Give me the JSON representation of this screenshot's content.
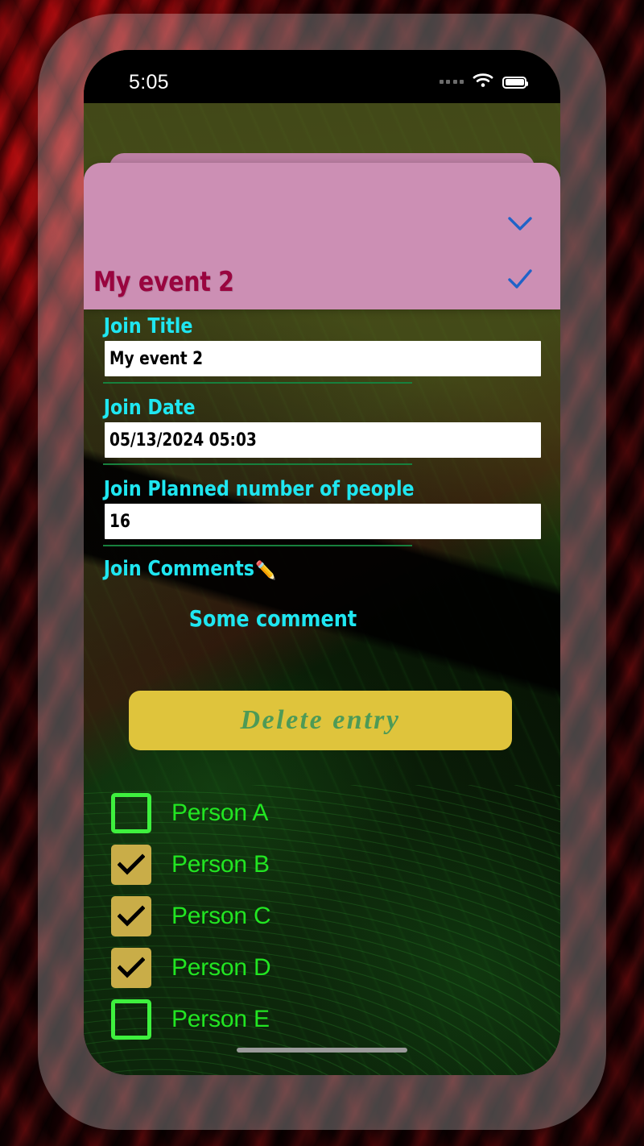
{
  "status_bar": {
    "time": "5:05",
    "signal_icon": "signal-dots-icon",
    "wifi_icon": "wifi-icon",
    "battery_icon": "battery-icon"
  },
  "event_card": {
    "title": "My event 2",
    "background_color": "#CC8FB4",
    "title_color": "#99053F",
    "chevron_icon": "chevron-down-icon",
    "check_icon": "check-icon",
    "icon_color": "#1F63C8"
  },
  "form": {
    "label_color": "#1FE6F0",
    "underline_color": "#17803D",
    "fields": [
      {
        "label": "Join Title",
        "value": "My event 2"
      },
      {
        "label": "Join Date",
        "value": "05/13/2024 05:03"
      },
      {
        "label": "Join Planned number of people",
        "value": "16"
      }
    ],
    "comments_label": "Join Comments",
    "comments_icon": "pencil-icon",
    "comments_emoji": "✏️",
    "comment_value": "Some comment"
  },
  "actions": {
    "delete_label": "Delete entry",
    "delete_bg_color": "#DFC43C",
    "delete_text_color": "#4E9A56"
  },
  "people": {
    "checked_color": "#C9AD48",
    "unchecked_color": "#3EF03E",
    "label_color": "#22E522",
    "items": [
      {
        "name": "Person A",
        "checked": false
      },
      {
        "name": "Person B",
        "checked": true
      },
      {
        "name": "Person C",
        "checked": true
      },
      {
        "name": "Person D",
        "checked": true
      },
      {
        "name": "Person E",
        "checked": false
      }
    ]
  }
}
